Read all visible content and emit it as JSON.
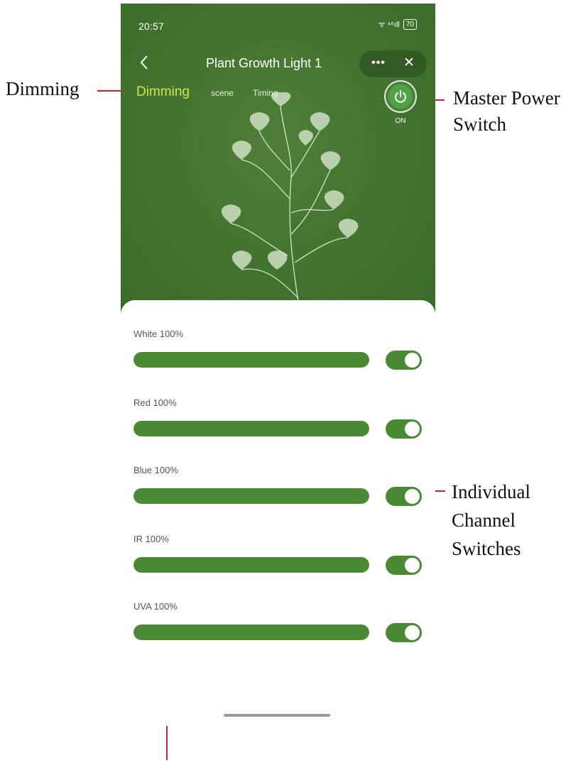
{
  "status_bar": {
    "time": "20:57",
    "signal": "ᯤ ⁴⁶ıll",
    "battery": "70"
  },
  "header": {
    "title": "Plant Growth Light 1",
    "back_icon": "chevron-left-icon",
    "more_label": "•••",
    "close_label": "✕"
  },
  "tabs": [
    {
      "label": "Dimming",
      "active": true
    },
    {
      "label": "scene",
      "active": false
    },
    {
      "label": "Timing",
      "active": false
    }
  ],
  "power": {
    "state_label": "ON",
    "icon": "power-icon"
  },
  "channels": [
    {
      "label": "White 100%",
      "level": 1.0,
      "enabled": true
    },
    {
      "label": "Red 100%",
      "level": 1.0,
      "enabled": true
    },
    {
      "label": "Blue 100%",
      "level": 1.0,
      "enabled": true
    },
    {
      "label": "IR 100%",
      "level": 1.0,
      "enabled": true
    },
    {
      "label": "UVA 100%",
      "level": 1.0,
      "enabled": true
    }
  ],
  "annotations": {
    "dimming": "Dimming",
    "master_power_line1": "Master Power",
    "master_power_line2": "Switch",
    "individual_line1": "Individual",
    "individual_line2": "Channel",
    "individual_line3": "Switches"
  },
  "colors": {
    "accent_green": "#4a8a35",
    "active_tab": "#cfe34f",
    "callout_red": "#c4232b"
  }
}
